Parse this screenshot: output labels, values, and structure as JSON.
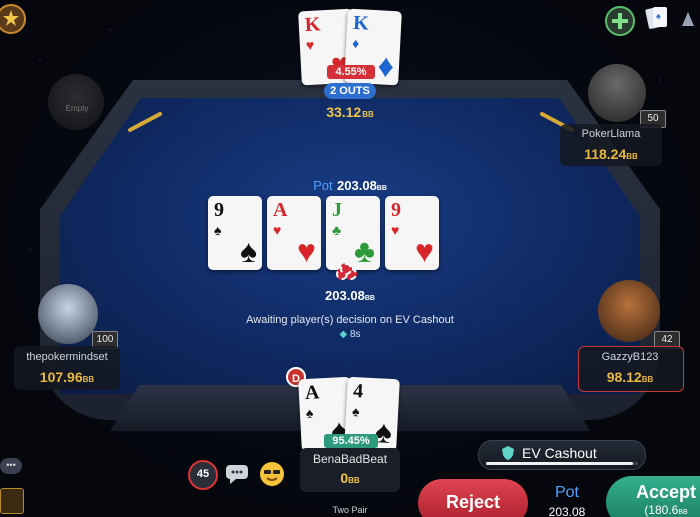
{
  "top_player": {
    "cards": [
      {
        "rank": "K",
        "suit": "♥",
        "color": "red"
      },
      {
        "rank": "K",
        "suit": "♦",
        "color": "blue"
      }
    ],
    "equity": "4.55%",
    "outs": "2 OUTS",
    "stack": "33.12",
    "unit": "BB"
  },
  "players": {
    "pokerllama": {
      "name": "PokerLlama",
      "stack": "118.24",
      "unit": "BB",
      "level": "50"
    },
    "thepokermindset": {
      "name": "thepokermindset",
      "stack": "107.96",
      "unit": "BB",
      "level": "100"
    },
    "gazzy": {
      "name": "GazzyB123",
      "stack": "98.12",
      "unit": "BB",
      "level": "42"
    },
    "top_left": {
      "name": "Empty"
    }
  },
  "board": {
    "pot_label": "Pot",
    "pot_value": "203.08",
    "unit": "BB",
    "cards": [
      {
        "rank": "9",
        "suit": "♠",
        "color": "black"
      },
      {
        "rank": "A",
        "suit": "♥",
        "color": "red"
      },
      {
        "rank": "J",
        "suit": "♣",
        "color": "green"
      },
      {
        "rank": "9",
        "suit": "♥",
        "color": "red"
      }
    ],
    "center_pot": "203.08",
    "status": "Awaiting player(s) decision on EV Cashout",
    "timer": "8s"
  },
  "hero": {
    "cards": [
      {
        "rank": "A",
        "suit": "♠",
        "color": "black"
      },
      {
        "rank": "4",
        "suit": "♠",
        "color": "black"
      }
    ],
    "equity": "95.45%",
    "name": "BenaBadBeat",
    "stack": "0",
    "unit": "BB",
    "hand_desc": "Two Pair",
    "dealer_label": "D"
  },
  "actions": {
    "ev_cashout_label": "EV Cashout",
    "ev_progress": 0.97,
    "reject_label": "Reject",
    "pot_label": "Pot",
    "pot_value": "203.08",
    "accept_label": "Accept",
    "accept_value": "(180.6",
    "accept_unit": "BB"
  },
  "hud": {
    "timer_badge": "45",
    "side_tab": "•••"
  },
  "colors": {
    "felt": "#1a3d86",
    "reject": "#d5303a",
    "accept": "#2e9a7d",
    "stack_gold": "#f1c644",
    "pot_blue": "#4da3ff"
  }
}
